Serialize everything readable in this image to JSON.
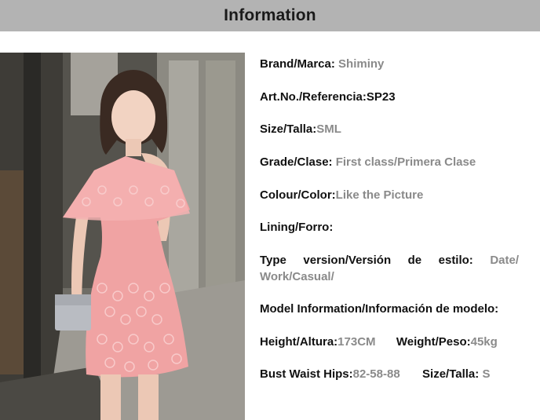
{
  "header": {
    "title": "Information"
  },
  "photo": {
    "description_icon": "product-photo"
  },
  "specs": {
    "brand": {
      "label": "Brand/Marca:",
      "value": "Shiminy"
    },
    "article": {
      "label": "Art.No./Referencia:",
      "value": "SP23"
    },
    "size": {
      "label": "Size/Talla:",
      "value": "SML"
    },
    "grade": {
      "label": "Grade/Clase:",
      "value": "First class/Primera Clase"
    },
    "colour": {
      "label": "Colour/Color:",
      "value": "Like the Picture"
    },
    "lining": {
      "label": "Lining/Forro:",
      "value": ""
    },
    "type": {
      "label": "Type version/Versión de estilo:",
      "value": "Date/ Work/Casual/"
    },
    "model": {
      "label": "Model Information/Información de modelo:"
    },
    "height": {
      "label": "Height/Altura:",
      "value": "173CM"
    },
    "weight": {
      "label": "Weight/Peso:",
      "value": "45kg"
    },
    "bwh": {
      "label": "Bust Waist Hips:",
      "value": "82-58-88"
    },
    "model_size": {
      "label": "Size/Talla:",
      "value": "S"
    }
  },
  "colors": {
    "header_bg": "#b3b3b3",
    "value_gray": "#8a8a8a",
    "dress_pink": "#f0a3a3"
  }
}
